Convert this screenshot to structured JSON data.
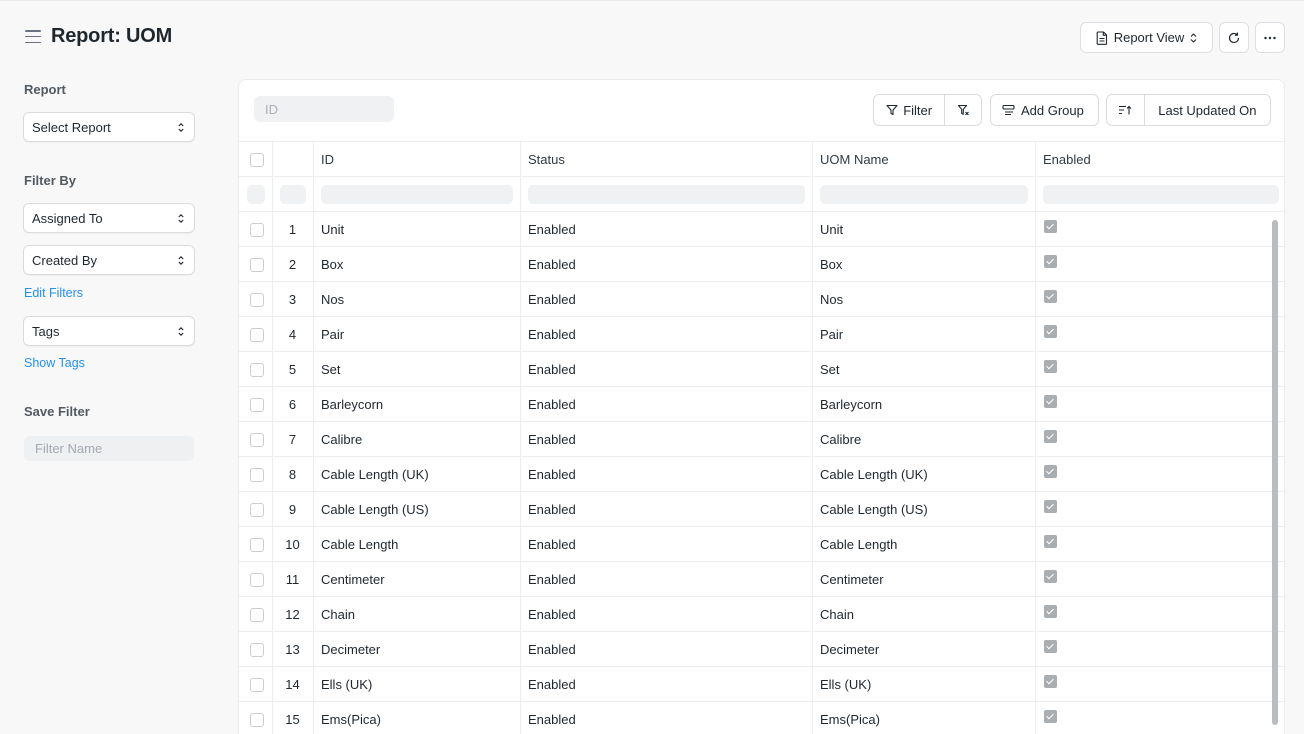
{
  "header": {
    "title": "Report: UOM",
    "report_view_label": "Report View"
  },
  "sidebar": {
    "report_label": "Report",
    "select_report": "Select Report",
    "filter_by_label": "Filter By",
    "assigned_to": "Assigned To",
    "created_by": "Created By",
    "edit_filters": "Edit Filters",
    "tags": "Tags",
    "show_tags": "Show Tags",
    "save_filter_label": "Save Filter",
    "filter_name_placeholder": "Filter Name"
  },
  "toolbar": {
    "id_placeholder": "ID",
    "filter_label": "Filter",
    "add_group_label": "Add Group",
    "sort_label": "Last Updated On"
  },
  "table": {
    "columns": [
      "ID",
      "Status",
      "UOM Name",
      "Enabled"
    ],
    "rows": [
      {
        "n": "1",
        "id": "Unit",
        "status": "Enabled",
        "name": "Unit"
      },
      {
        "n": "2",
        "id": "Box",
        "status": "Enabled",
        "name": "Box"
      },
      {
        "n": "3",
        "id": "Nos",
        "status": "Enabled",
        "name": "Nos"
      },
      {
        "n": "4",
        "id": "Pair",
        "status": "Enabled",
        "name": "Pair"
      },
      {
        "n": "5",
        "id": "Set",
        "status": "Enabled",
        "name": "Set"
      },
      {
        "n": "6",
        "id": "Barleycorn",
        "status": "Enabled",
        "name": "Barleycorn"
      },
      {
        "n": "7",
        "id": "Calibre",
        "status": "Enabled",
        "name": "Calibre"
      },
      {
        "n": "8",
        "id": "Cable Length (UK)",
        "status": "Enabled",
        "name": "Cable Length (UK)"
      },
      {
        "n": "9",
        "id": "Cable Length (US)",
        "status": "Enabled",
        "name": "Cable Length (US)"
      },
      {
        "n": "10",
        "id": "Cable Length",
        "status": "Enabled",
        "name": "Cable Length"
      },
      {
        "n": "11",
        "id": "Centimeter",
        "status": "Enabled",
        "name": "Centimeter"
      },
      {
        "n": "12",
        "id": "Chain",
        "status": "Enabled",
        "name": "Chain"
      },
      {
        "n": "13",
        "id": "Decimeter",
        "status": "Enabled",
        "name": "Decimeter"
      },
      {
        "n": "14",
        "id": "Ells (UK)",
        "status": "Enabled",
        "name": "Ells (UK)"
      },
      {
        "n": "15",
        "id": "Ems(Pica)",
        "status": "Enabled",
        "name": "Ems(Pica)"
      }
    ]
  }
}
